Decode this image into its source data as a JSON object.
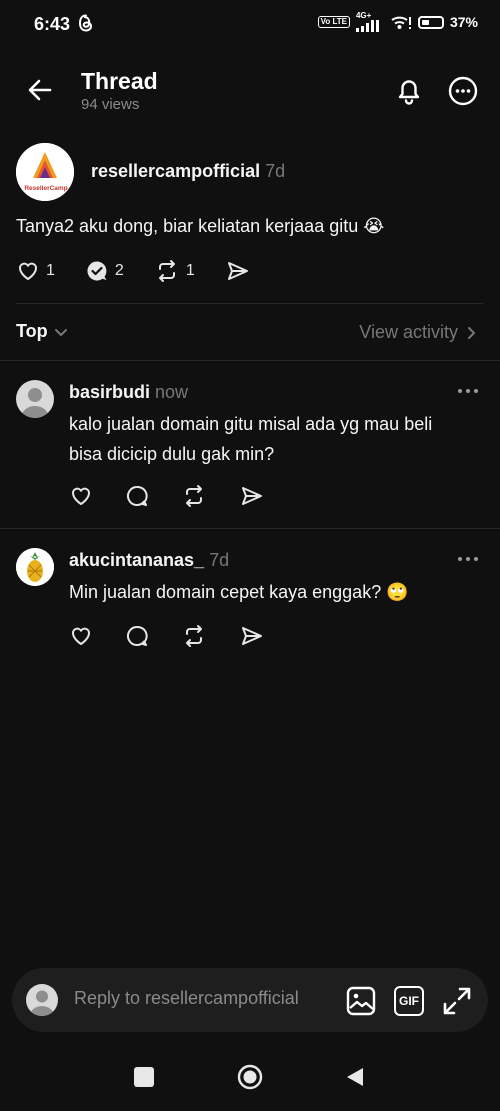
{
  "status_bar": {
    "time": "6:43",
    "network_label": "4G+",
    "volte_label": "Vo LTE",
    "battery_percent": "37%",
    "battery_level": 0.37
  },
  "header": {
    "title": "Thread",
    "views": "94 views"
  },
  "post": {
    "username": "resellercampofficial",
    "time": "7d",
    "avatar_text": "ResellerCamp",
    "text": "Tanya2 aku dong, biar keliatan kerjaaa gitu 😭",
    "likes": "1",
    "replies": "2",
    "reposts": "1"
  },
  "sort": {
    "label": "Top",
    "view_activity": "View activity"
  },
  "replies": [
    {
      "username": "basirbudi",
      "time": "now",
      "line1": "kalo jualan domain gitu misal ada yg mau beli",
      "line2": "bisa dicicip dulu gak min?"
    },
    {
      "username": "akucintananas_",
      "time": "7d",
      "line1": "Min jualan domain cepet kaya enggak? 🙄"
    }
  ],
  "reply_bar": {
    "placeholder": "Reply to resellercampofficial",
    "gif_label": "GIF"
  },
  "colors": {
    "background": "#101010",
    "text": "#f3f5f7",
    "muted": "#777777",
    "divider": "#262626",
    "reply_bar": "#1e1e1e"
  }
}
